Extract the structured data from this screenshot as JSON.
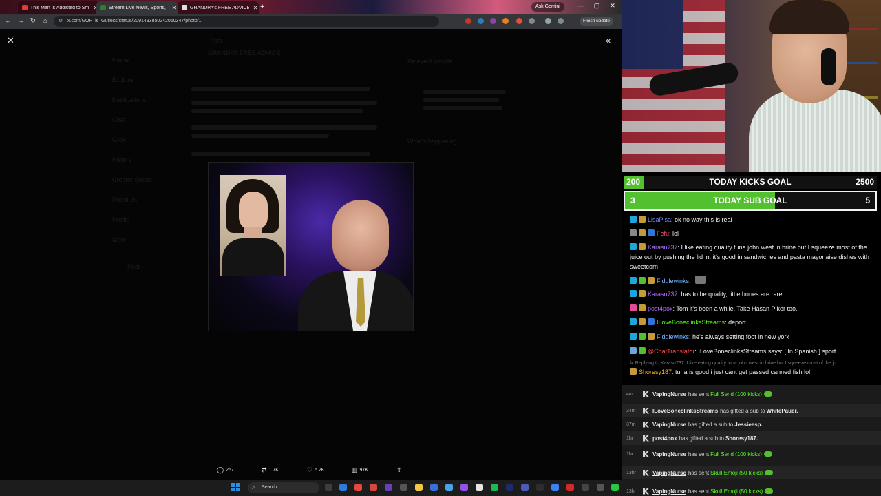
{
  "browser": {
    "tabs": [
      {
        "title": "This Man Is Addicted to Smel",
        "color": "#e53935"
      },
      {
        "title": "Stream Live News, Sports, T",
        "color": "#2e7d32"
      },
      {
        "title": "GRANDPA's FREE ADVICE on X",
        "color": "#e0e0e0"
      }
    ],
    "new_tab": "+",
    "ask_gemini": "Ask Gemini",
    "url": "x.com/GOP_is_Gutless/status/2091493850242060347/photo/1",
    "finish_update": "Finish update",
    "window_controls": [
      "—",
      "▢",
      "✕"
    ]
  },
  "x_photo_view": {
    "close_glyph": "✕",
    "collapse_glyph": "«",
    "ghost_sidebar": [
      "Home",
      "Explore",
      "Notifications",
      "Chat",
      "Grok",
      "History",
      "Creator Studio",
      "Premium",
      "Profile",
      "More"
    ],
    "ghost_post_btn": "Post",
    "ghost_header": "Post",
    "ghost_relevant": "Relevant people",
    "ghost_happening": "What's happening",
    "ghost_account": "GRANDPA FREE ADVICE",
    "actions": {
      "replies": "257",
      "reposts": "1.7K",
      "likes": "5.2K",
      "views": "97K"
    }
  },
  "taskbar": {
    "search_placeholder": "Search"
  },
  "goals": {
    "kicks": {
      "current": "200",
      "label": "TODAY KICKS GOAL",
      "target": "2500",
      "progress": 0.08
    },
    "subs": {
      "current": "3",
      "label": "TODAY SUB GOAL",
      "target": "5",
      "progress": 0.6
    }
  },
  "chat": {
    "messages": [
      {
        "user": "LisaPisa",
        "color": "#7b8cff",
        "text": ": ok no way this is real"
      },
      {
        "user": "Fefu",
        "color": "#ff4d6d",
        "text": ": lol"
      },
      {
        "user": "Karasu737",
        "color": "#b66bff",
        "text": ": I like eating quality tuna john west in brine but I squeeze most of the juice out by pushing the lid in. it's good in sandwiches and pasta mayonaise dishes with sweetcorn"
      },
      {
        "user": "Fiddlewinks",
        "color": "#7ab8ff",
        "text": ":"
      },
      {
        "user": "Karasu737",
        "color": "#b66bff",
        "text": ": has to be quality, little bones are rare"
      },
      {
        "user": "post4pox",
        "color": "#b66bff",
        "text": ": Tom it's been a while. Take Hasan Piker too."
      },
      {
        "user": "ILoveBoneclinksStreams",
        "color": "#53fc18",
        "text": ": deport"
      },
      {
        "user": "Fiddlewinks",
        "color": "#7ab8ff",
        "text": ": he's always setting foot in new york"
      },
      {
        "user": "@ChatTranslator",
        "color": "#ff4d4d",
        "text": ": ILoveBoneclinksStreams says: [ In Spanish ] sport"
      },
      {
        "user": "Shoresy187",
        "color": "#ffb020",
        "text": ": tuna is good i just cant get passed canned fish lol"
      }
    ],
    "reply_context": "↳ Replying to Karasu737: I like eating quality tuna john west in brine but I squeeze most of the ju..."
  },
  "events": [
    {
      "time": "4m",
      "user": "VapingNurse",
      "underline": true,
      "action": "has sent",
      "item": "Full Send (100 kicks)",
      "item_color": "green"
    },
    {
      "time": "34m",
      "user": "ILoveBoneclinksStreams",
      "underline": false,
      "action": "has gifted a sub to",
      "item": "WhitePauer.",
      "item_color": "bold"
    },
    {
      "time": "37m",
      "user": "VapingNurse",
      "underline": false,
      "action": "has gifted a sub to",
      "item": "Jessieesp.",
      "item_color": "bold"
    },
    {
      "time": "1hr",
      "user": "post4pox",
      "underline": false,
      "action": "has gifted a sub to",
      "item": "Shoresy187.",
      "item_color": "bold"
    },
    {
      "time": "1hr",
      "user": "VapingNurse",
      "underline": true,
      "action": "has sent",
      "item": "Full Send (100 kicks)",
      "item_color": "green"
    },
    {
      "time": "13hr",
      "user": "VapingNurse",
      "underline": true,
      "action": "has sent",
      "item": "Skull Emoji (50 kicks)",
      "item_color": "green"
    },
    {
      "time": "13hr",
      "user": "VapingNurse",
      "underline": true,
      "action": "has sent",
      "item": "Skull Emoji (50 kicks)",
      "item_color": "green"
    }
  ]
}
